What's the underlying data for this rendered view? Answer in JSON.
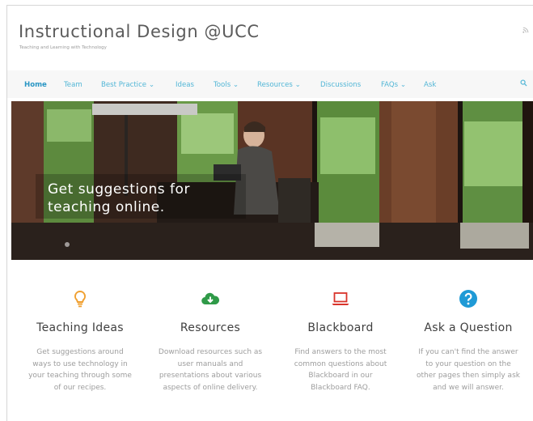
{
  "site": {
    "title": "Instructional Design @UCC",
    "tagline": "Teaching and Learning with Technology"
  },
  "header_icons": {
    "rss": "rss-icon",
    "search": "search-icon"
  },
  "nav": {
    "items": [
      {
        "label": "Home",
        "active": true
      },
      {
        "label": "Team"
      },
      {
        "label": "Best Practice ⌄"
      },
      {
        "label": "Ideas"
      },
      {
        "label": "Tools ⌄"
      },
      {
        "label": "Resources ⌄"
      },
      {
        "label": "Discussions"
      },
      {
        "label": "FAQs ⌄"
      },
      {
        "label": "Ask"
      }
    ]
  },
  "hero": {
    "caption_line1": "Get suggestions for",
    "caption_line2": "teaching online."
  },
  "features": [
    {
      "icon": "lightbulb-icon",
      "color": "#f0a030",
      "title": "Teaching Ideas",
      "text": "Get suggestions around ways to use technology in your teaching through some of our recipes."
    },
    {
      "icon": "cloud-download-icon",
      "color": "#2f9a48",
      "title": "Resources",
      "text": "Download resources such as user manuals and presentations about various aspects of online delivery."
    },
    {
      "icon": "laptop-icon",
      "color": "#d9342b",
      "title": "Blackboard",
      "text": "Find answers to the most common questions about Blackboard in our Blackboard FAQ."
    },
    {
      "icon": "question-circle-icon",
      "color": "#1f9ad6",
      "title": "Ask a Question",
      "text": "If you can't find the answer to your question on the other pages then simply ask and we will answer."
    }
  ],
  "colors": {
    "nav_link": "#52b6d6",
    "nav_active": "#2a96c4"
  }
}
